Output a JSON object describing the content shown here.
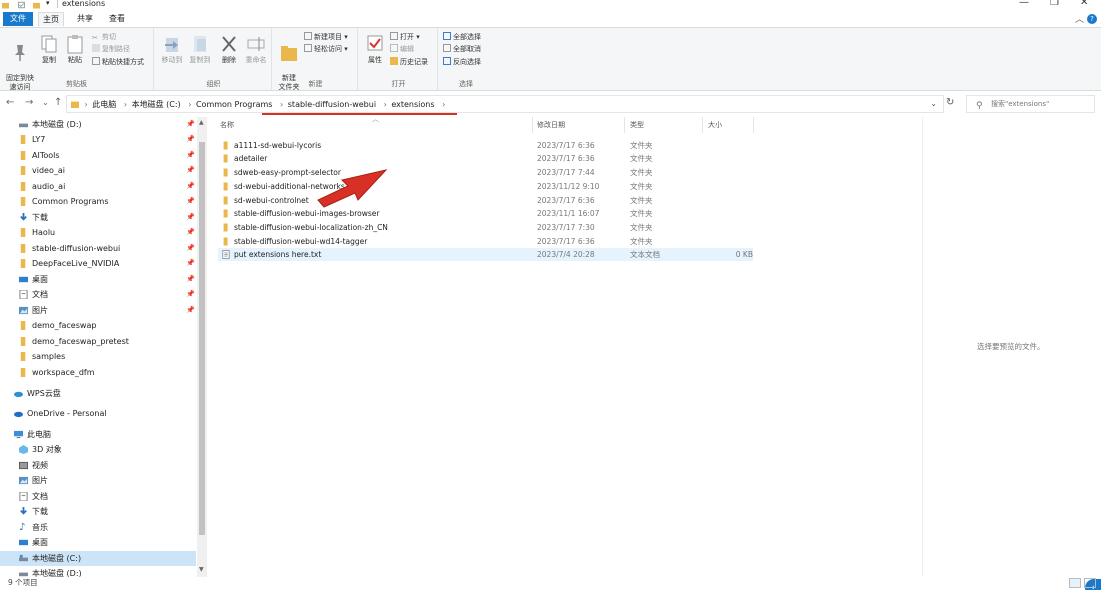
{
  "titlebar": {
    "title": "extensions",
    "minimize": "—",
    "maximize": "❐",
    "close": "✕"
  },
  "ribbon_tabs": {
    "file": "文件",
    "home": "主页",
    "share": "共享",
    "view": "查看",
    "help": "?"
  },
  "ribbon": {
    "clipboard": {
      "label": "剪贴板",
      "pin_quick": "固定到快\n速访问",
      "copy": "复制",
      "paste": "粘贴",
      "cut": "剪切",
      "copy_path": "复制路径",
      "paste_shortcut": "粘贴快捷方式"
    },
    "organize": {
      "label": "组织",
      "move_to": "移动到",
      "copy_to": "复制到",
      "delete": "删除",
      "rename": "重命名"
    },
    "new": {
      "label": "新建",
      "new_folder": "新建\n文件夹",
      "new_item": "新建项目 ▾",
      "easy_access": "轻松访问 ▾"
    },
    "open": {
      "label": "打开",
      "properties": "属性",
      "open": "打开 ▾",
      "edit": "编辑",
      "history": "历史记录"
    },
    "select": {
      "label": "选择",
      "select_all": "全部选择",
      "select_none": "全部取消",
      "invert": "反向选择"
    }
  },
  "address": {
    "crumbs": [
      "此电脑",
      "本地磁盘 (C:)",
      "Common Programs",
      "stable-diffusion-webui",
      "extensions"
    ],
    "search_placeholder": "搜索\"extensions\""
  },
  "nav_pane": {
    "items": [
      {
        "label": "本地磁盘 (D:)",
        "icon": "drive-icon",
        "pinned": true
      },
      {
        "label": "LY7",
        "icon": "folder-icon",
        "pinned": true
      },
      {
        "label": "AITools",
        "icon": "folder-icon",
        "pinned": true
      },
      {
        "label": "video_ai",
        "icon": "folder-icon",
        "pinned": true
      },
      {
        "label": "audio_ai",
        "icon": "folder-icon",
        "pinned": true
      },
      {
        "label": "Common Programs",
        "icon": "folder-icon",
        "pinned": true
      },
      {
        "label": "下载",
        "icon": "download-icon",
        "pinned": true
      },
      {
        "label": "Haolu",
        "icon": "folder-icon",
        "pinned": true
      },
      {
        "label": "stable-diffusion-webui",
        "icon": "folder-icon",
        "pinned": true
      },
      {
        "label": "DeepFaceLive_NVIDIA",
        "icon": "folder-icon",
        "pinned": true
      },
      {
        "label": "桌面",
        "icon": "desktop-icon",
        "pinned": true
      },
      {
        "label": "文档",
        "icon": "document-icon",
        "pinned": true
      },
      {
        "label": "图片",
        "icon": "picture-icon",
        "pinned": true
      },
      {
        "label": "demo_faceswap",
        "icon": "folder-icon",
        "pinned": false
      },
      {
        "label": "demo_faceswap_pretest",
        "icon": "folder-icon",
        "pinned": false
      },
      {
        "label": "samples",
        "icon": "folder-icon",
        "pinned": false
      },
      {
        "label": "workspace_dfm",
        "icon": "folder-icon",
        "pinned": false
      }
    ],
    "wps": "WPS云盘",
    "onedrive": "OneDrive - Personal",
    "this_pc": "此电脑",
    "pc_items": [
      {
        "label": "3D 对象",
        "icon": "cube-icon"
      },
      {
        "label": "视频",
        "icon": "video-icon"
      },
      {
        "label": "图片",
        "icon": "picture-icon"
      },
      {
        "label": "文档",
        "icon": "document-icon"
      },
      {
        "label": "下载",
        "icon": "download-icon"
      },
      {
        "label": "音乐",
        "icon": "music-icon"
      },
      {
        "label": "桌面",
        "icon": "desktop-icon"
      },
      {
        "label": "本地磁盘 (C:)",
        "icon": "drive-icon"
      },
      {
        "label": "本地磁盘 (D:)",
        "icon": "drive-icon"
      }
    ]
  },
  "file_list": {
    "columns": {
      "name": "名称",
      "date": "修改日期",
      "type": "类型",
      "size": "大小"
    },
    "rows": [
      {
        "name": "a1111-sd-webui-lycoris",
        "date": "2023/7/17 6:36",
        "type": "文件夹",
        "size": ""
      },
      {
        "name": "adetailer",
        "date": "2023/7/17 6:36",
        "type": "文件夹",
        "size": ""
      },
      {
        "name": "sdweb-easy-prompt-selector",
        "date": "2023/7/17 7:44",
        "type": "文件夹",
        "size": ""
      },
      {
        "name": "sd-webui-additional-networks",
        "date": "2023/11/12 9:10",
        "type": "文件夹",
        "size": ""
      },
      {
        "name": "sd-webui-controlnet",
        "date": "2023/7/17 6:36",
        "type": "文件夹",
        "size": ""
      },
      {
        "name": "stable-diffusion-webui-images-browser",
        "date": "2023/11/1 16:07",
        "type": "文件夹",
        "size": ""
      },
      {
        "name": "stable-diffusion-webui-localization-zh_CN",
        "date": "2023/7/17 7:30",
        "type": "文件夹",
        "size": ""
      },
      {
        "name": "stable-diffusion-webui-wd14-tagger",
        "date": "2023/7/17 6:36",
        "type": "文件夹",
        "size": ""
      },
      {
        "name": "put extensions here.txt",
        "date": "2023/7/4 20:28",
        "type": "文本文档",
        "size": "0 KB"
      }
    ]
  },
  "preview": {
    "placeholder": "选择要预览的文件。"
  },
  "status": {
    "count": "9 个项目"
  },
  "colors": {
    "accent": "#1979ca",
    "folder": "#e8b84a",
    "annotation": "#d93025"
  }
}
